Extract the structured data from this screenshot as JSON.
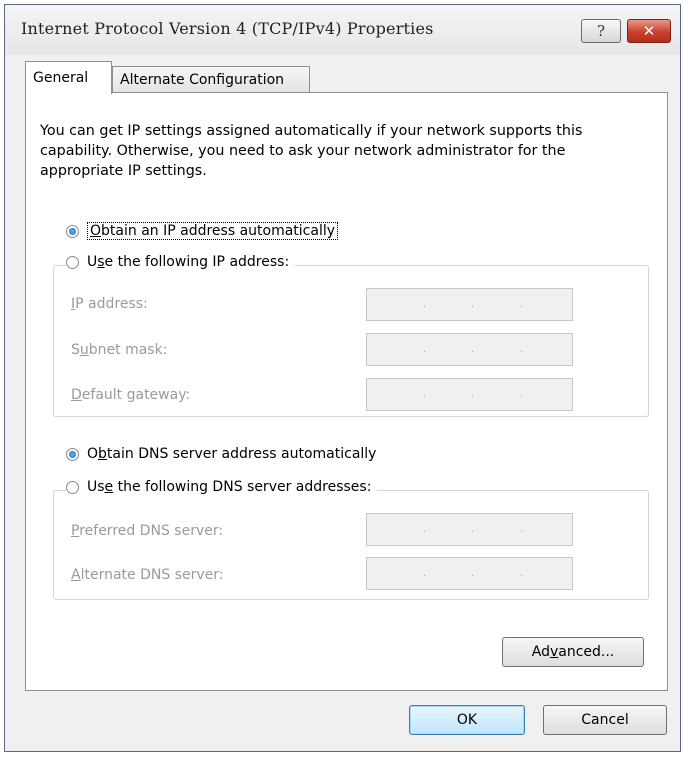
{
  "window": {
    "title": "Internet Protocol Version 4 (TCP/IPv4) Properties",
    "help_label": "?",
    "close_label": "✕"
  },
  "tabs": [
    {
      "label": "General"
    },
    {
      "label": "Alternate Configuration"
    }
  ],
  "description": "You can get IP settings assigned automatically if your network supports this capability. Otherwise, you need to ask your network administrator for the appropriate IP settings.",
  "ip": {
    "auto": {
      "pre": "",
      "key": "O",
      "post": "btain an IP address automatically",
      "selected": true
    },
    "manual": {
      "pre": "U",
      "key": "s",
      "post": "e the following IP address:",
      "selected": false
    },
    "fields": [
      {
        "pre": "",
        "key": "I",
        "post": "P address:",
        "value": ". . ."
      },
      {
        "pre": "S",
        "key": "u",
        "post": "bnet mask:",
        "value": ". . ."
      },
      {
        "pre": "",
        "key": "D",
        "post": "efault gateway:",
        "value": ". . ."
      }
    ]
  },
  "dns": {
    "auto": {
      "pre": "O",
      "key": "b",
      "post": "tain DNS server address automatically",
      "selected": true
    },
    "manual": {
      "pre": "Us",
      "key": "e",
      "post": " the following DNS server addresses:",
      "selected": false
    },
    "fields": [
      {
        "pre": "",
        "key": "P",
        "post": "referred DNS server:",
        "value": ". . ."
      },
      {
        "pre": "",
        "key": "A",
        "post": "lternate DNS server:",
        "value": ". . ."
      }
    ]
  },
  "buttons": {
    "advanced": {
      "pre": "Ad",
      "key": "v",
      "post": "anced..."
    },
    "ok": "OK",
    "cancel": "Cancel"
  }
}
